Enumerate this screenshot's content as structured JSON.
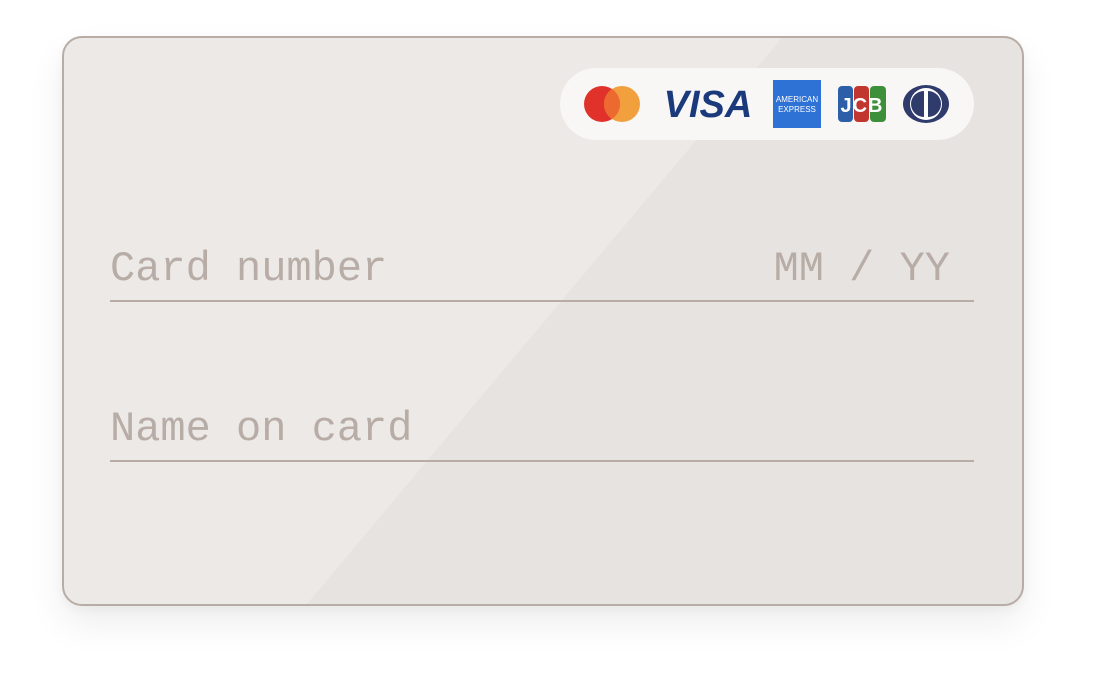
{
  "card": {
    "accepted_brands": [
      {
        "name": "Mastercard",
        "icon": "mastercard-icon",
        "colors": [
          "#e0312b",
          "#f2a03d"
        ]
      },
      {
        "name": "Visa",
        "icon": "visa-icon",
        "text": "VISA",
        "color": "#1a3a7c"
      },
      {
        "name": "American Express",
        "icon": "amex-icon",
        "text_top": "AMERICAN",
        "text_bottom": "EXPRESS",
        "color": "#2f72d6"
      },
      {
        "name": "JCB",
        "icon": "jcb-icon",
        "text": "JCB",
        "colors": [
          "#2d5fa8",
          "#c1362f",
          "#3d8f3a"
        ]
      },
      {
        "name": "Diners Club",
        "icon": "diners-club-icon",
        "color": "#2f3b6b"
      }
    ],
    "card_number": {
      "value": "",
      "placeholder": "Card number"
    },
    "expiry": {
      "value": "",
      "placeholder": "MM / YY"
    },
    "name_on_card": {
      "value": "",
      "placeholder": "Name on card"
    }
  },
  "colors": {
    "card_background": "#e7e3e0",
    "card_border": "#b8ada6",
    "placeholder": "#b8ada6",
    "pill_background": "#f8f7f6"
  }
}
